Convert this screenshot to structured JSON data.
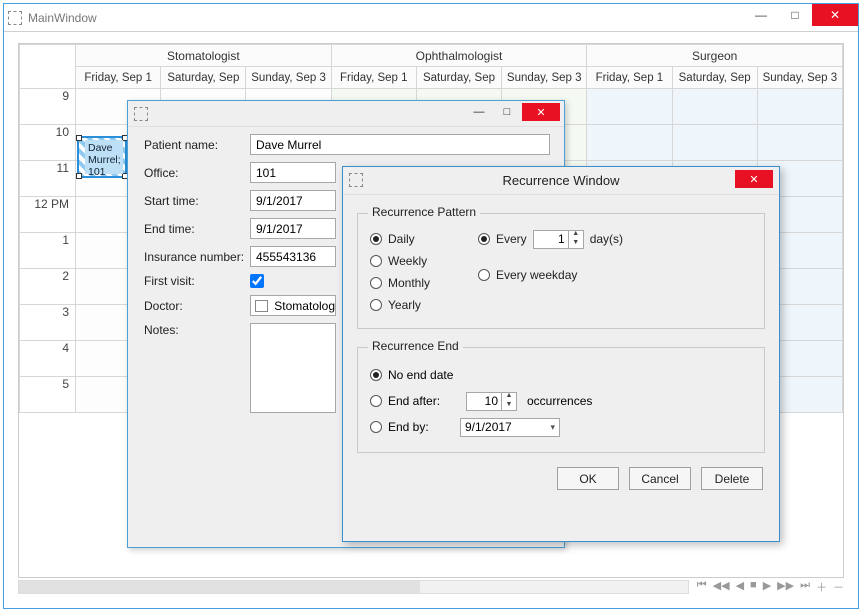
{
  "window": {
    "title": "MainWindow",
    "minimize": "—",
    "maximize": "□",
    "close": "✕"
  },
  "scheduler": {
    "groups": [
      "Stomatologist",
      "Ophthalmologist",
      "Surgeon"
    ],
    "days": [
      "Friday, Sep 1",
      "Saturday, Sep",
      "Sunday, Sep 3"
    ],
    "time_labels": [
      "9",
      "10",
      "11",
      "12 PM",
      "1",
      "2",
      "3",
      "4",
      "5"
    ],
    "appointment": {
      "line1": "Dave",
      "line2": "Murrel;",
      "line3": "101"
    },
    "stray_cell": "101"
  },
  "nav_icons": [
    "⏮",
    "◀◀",
    "◀",
    "■",
    "▶",
    "▶▶",
    "⏭",
    "＋",
    "－"
  ],
  "edit": {
    "patient_name_label": "Patient name:",
    "patient_name_value": "Dave Murrel",
    "office_label": "Office:",
    "office_value": "101",
    "start_label": "Start time:",
    "start_value": "9/1/2017",
    "end_label": "End time:",
    "end_value": "9/1/2017",
    "insurance_label": "Insurance number:",
    "insurance_value": "455543136",
    "first_visit_label": "First visit:",
    "first_visit_checked": true,
    "doctor_label": "Doctor:",
    "doctor_value": "Stomatolog",
    "notes_label": "Notes:",
    "minimize": "—",
    "maximize": "□",
    "close": "✕"
  },
  "recurrence": {
    "title": "Recurrence Window",
    "close": "✕",
    "pattern_group": "Recurrence Pattern",
    "daily": "Daily",
    "weekly": "Weekly",
    "monthly": "Monthly",
    "yearly": "Yearly",
    "every": "Every",
    "every_value": "1",
    "days_suffix": "day(s)",
    "every_weekday": "Every weekday",
    "end_group": "Recurrence End",
    "no_end": "No end date",
    "end_after": "End after:",
    "end_after_value": "10",
    "occurrences": "occurrences",
    "end_by": "End by:",
    "end_by_value": "9/1/2017",
    "ok": "OK",
    "cancel": "Cancel",
    "delete": "Delete"
  }
}
